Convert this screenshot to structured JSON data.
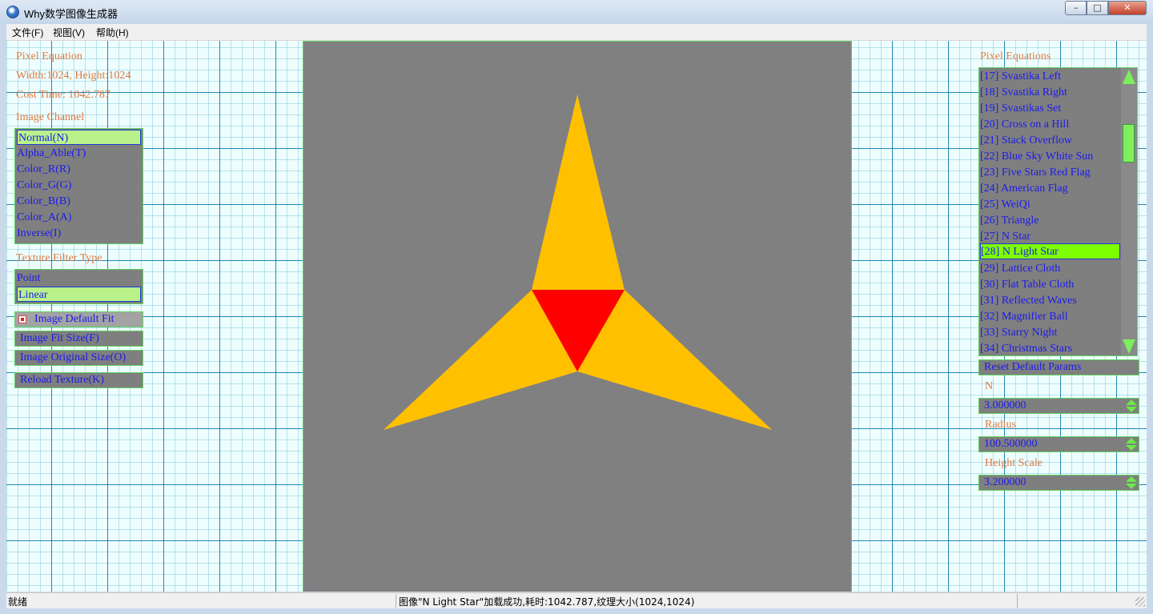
{
  "window": {
    "title": "Why数学图像生成器"
  },
  "menu": {
    "file": "文件(F)",
    "view": "视图(V)",
    "help": "帮助(H)"
  },
  "left_panel": {
    "heading": "Pixel Equation",
    "size": "Width:1024, Height:1024",
    "cost": "Cost Time: 1042.787",
    "channel_label": "Image Channel",
    "channels": [
      "Normal(N)",
      "Alpha_Able(T)",
      "Color_R(R)",
      "Color_G(G)",
      "Color_B(B)",
      "Color_A(A)",
      "Inverse(I)"
    ],
    "channel_selected": "Normal(N)",
    "filter_label": "Texture Filter Type",
    "filters": [
      "Point",
      "Linear"
    ],
    "filter_selected": "Linear",
    "default_fit": "Image Default Fit",
    "fit_size": "Image Fit Size(F)",
    "original_size": "Image Original Size(O)",
    "reload": "Reload Texture(K)"
  },
  "right_panel": {
    "heading": "Pixel Equations",
    "equations": [
      "[17] Svastika Left",
      "[18] Svastika Right",
      "[19] Svastikas Set",
      "[20] Cross on a Hill",
      "[21] Stack Overflow",
      "[22] Blue Sky White Sun",
      "[23] Five Stars Red Flag",
      "[24] American Flag",
      "[25] WeiQi",
      "[26] Triangle",
      "[27] N Star",
      "[28] N Light Star",
      "[29] Lattice Cloth",
      "[30] Flat Table Cloth",
      "[31] Reflected Waves",
      "[32] Magnifier Ball",
      "[33] Starry Night",
      "[34] Christmas Stars"
    ],
    "equation_selected": "[28] N Light Star",
    "reset": "Reset Default Params",
    "params": [
      {
        "label": "N",
        "value": "3.000000"
      },
      {
        "label": "Radius",
        "value": "100.500000"
      },
      {
        "label": "Height Scale",
        "value": "3.200000"
      }
    ]
  },
  "image": {
    "background": "#808080",
    "star_color": "#ffc000",
    "center_color": "#ff0000"
  },
  "status": {
    "ready": "就绪",
    "message": "图像\"N Light Star\"加载成功,耗时:1042.787,纹理大小(1024,1024)"
  },
  "colors": {
    "label": "#e07840",
    "list_text": "#1a1aee",
    "selected_channel": "#b9f28a",
    "selected_equation": "#7eff00",
    "border": "#5fd25f"
  }
}
